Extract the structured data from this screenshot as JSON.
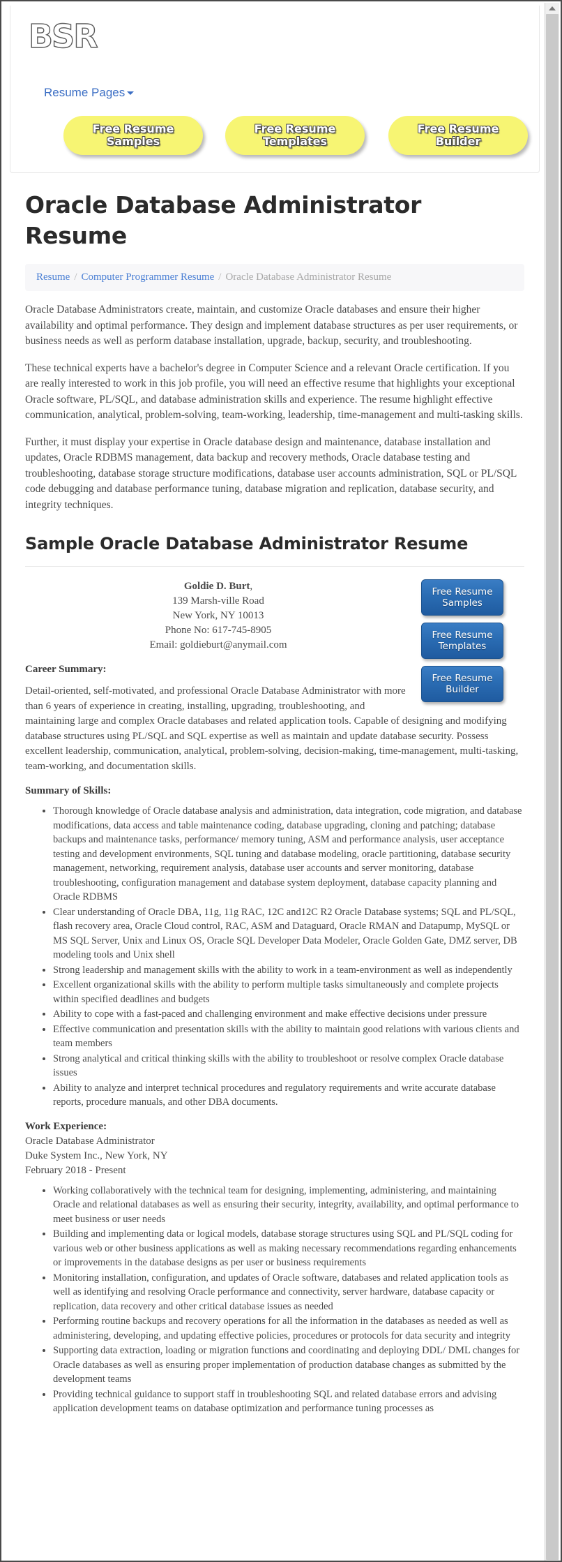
{
  "header": {
    "logo_text": "BSR",
    "nav_link": "Resume Pages",
    "yellow_buttons": [
      {
        "label": "Free Resume\nSamples"
      },
      {
        "label": "Free Resume\nTemplates"
      },
      {
        "label": "Free Resume\nBuilder"
      }
    ]
  },
  "page": {
    "title": "Oracle Database Administrator Resume",
    "breadcrumb": {
      "item1": "Resume",
      "item2": "Computer Programmer Resume",
      "current": "Oracle Database Administrator Resume",
      "separator": "/"
    },
    "intro_paragraphs": [
      "Oracle Database Administrators create, maintain, and customize Oracle databases and ensure their higher availability and optimal performance. They design and implement database structures as per user requirements, or business needs as well as perform database installation, upgrade, backup, security, and troubleshooting.",
      "These technical experts have a bachelor's degree in Computer Science and a relevant Oracle certification. If you are really interested to work in this job profile, you will need an effective resume that highlights your exceptional Oracle software, PL/SQL, and database administration skills and experience. The resume highlight effective communication, analytical, problem-solving, team-working, leadership, time-management and multi-tasking skills.",
      "Further, it must display your expertise in Oracle database design and maintenance, database installation and updates, Oracle RDBMS management, data backup and recovery methods, Oracle database testing and troubleshooting, database storage structure modifications, database user accounts administration, SQL or PL/SQL code debugging and database performance tuning, database migration and replication, database security, and integrity techniques."
    ],
    "sample_heading": "Sample Oracle Database Administrator Resume"
  },
  "resume": {
    "blue_buttons": [
      {
        "label": "Free Resume\nSamples"
      },
      {
        "label": "Free Resume\nTemplates"
      },
      {
        "label": "Free Resume\nBuilder"
      }
    ],
    "contact": {
      "name": "Goldie D. Burt",
      "name_suffix": ",",
      "address": "139 Marsh-ville Road",
      "city_state_zip": "New York, NY 10013",
      "phone": "Phone No: 617-745-8905",
      "email": "Email: goldieburt@anymail.com"
    },
    "career_summary_label": "Career Summary:",
    "career_summary_text": "Detail-oriented, self-motivated, and professional Oracle Database Administrator with more than 6 years of experience in creating, installing, upgrading, troubleshooting, and maintaining large and complex Oracle databases and related application tools. Capable of designing and modifying database structures using PL/SQL and SQL expertise as well as maintain and update database security. Possess excellent leadership, communication, analytical, problem-solving, decision-making, time-management, multi-tasking, team-working, and documentation skills.",
    "skills_label": "Summary of Skills:",
    "skills": [
      "Thorough knowledge of Oracle database analysis and administration, data integration, code migration, and database modifications, data access and table maintenance coding, database upgrading, cloning and patching; database backups and maintenance tasks, performance/ memory tuning, ASM and performance analysis, user acceptance testing and development environments, SQL tuning and database modeling, oracle partitioning, database security management, networking, requirement analysis, database user accounts and server monitoring, database troubleshooting, configuration management and database system deployment, database capacity planning and Oracle RDBMS",
      "Clear understanding of Oracle DBA, 11g, 11g RAC, 12C and12C R2 Oracle Database systems; SQL and PL/SQL, flash recovery area, Oracle Cloud control, RAC, ASM and Dataguard, Oracle RMAN and Datapump, MySQL or MS SQL Server, Unix and Linux OS, Oracle SQL Developer Data Modeler, Oracle Golden Gate, DMZ server, DB modeling tools and Unix shell",
      "Strong leadership and management skills with the ability to work in a team-environment as well as independently",
      "Excellent organizational skills with the ability to perform multiple tasks simultaneously and complete projects within specified deadlines and budgets",
      "Ability to cope with a fast-paced and challenging environment and make effective decisions under pressure",
      "Effective communication and presentation skills with the ability to maintain good relations with various clients and team members",
      "Strong analytical and critical thinking skills with the ability to troubleshoot or resolve complex Oracle database issues",
      "Ability to analyze and interpret technical procedures and regulatory requirements and write accurate database reports, procedure manuals, and other DBA documents."
    ],
    "work_experience_label": "Work Experience:",
    "job": {
      "title": "Oracle Database Administrator",
      "company": "Duke System Inc., New York, NY",
      "dates": "February 2018 - Present"
    },
    "work_bullets": [
      "Working collaboratively with the technical team for designing, implementing, administering, and maintaining Oracle and relational databases as well as ensuring their security, integrity, availability, and optimal performance to meet business or user needs",
      "Building and implementing data or logical models, database storage structures using SQL and PL/SQL coding for various web or other business applications as well as making necessary recommendations regarding enhancements or improvements in the database designs as per user or business requirements",
      "Monitoring installation, configuration, and updates of Oracle software, databases and related application tools as well as identifying and resolving Oracle performance and connectivity, server hardware, database capacity or replication, data recovery and other critical database issues as needed",
      "Performing routine backups and recovery operations for all the information in the databases as needed as well as administering, developing, and updating effective policies, procedures or protocols for data security and integrity",
      "Supporting data extraction, loading or migration functions and coordinating and deploying DDL/ DML changes for Oracle databases as well as ensuring proper implementation of production database changes as submitted by the development teams",
      "Providing technical guidance to support staff in troubleshooting SQL and related database errors and advising application development teams on database optimization and performance tuning processes as"
    ]
  },
  "colors": {
    "link_blue": "#3b6ec4",
    "yellow_button": "#f7f573",
    "blue_button": "#2a6cb3",
    "breadcrumb_bg": "#f7f7f9"
  }
}
